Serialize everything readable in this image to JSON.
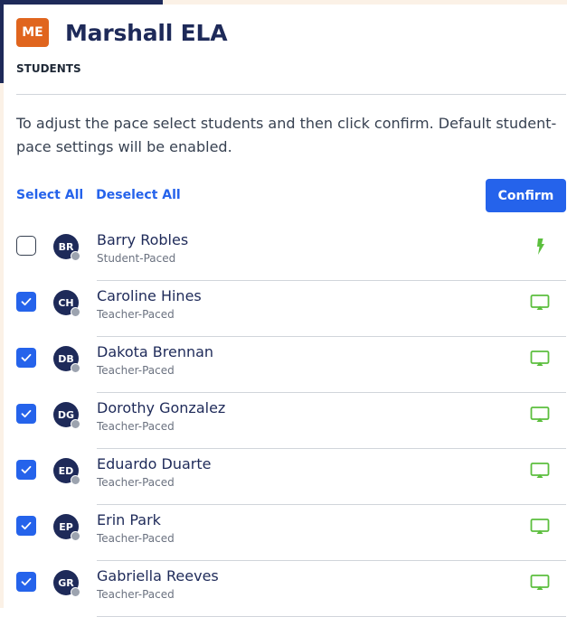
{
  "course": {
    "badge": "ME",
    "title": "Marshall ELA"
  },
  "section_label": "STUDENTS",
  "instructions": "To adjust the pace select students and then click confirm. Default student-pace settings will be enabled.",
  "actions": {
    "select_all": "Select All",
    "deselect_all": "Deselect All",
    "confirm": "Confirm"
  },
  "colors": {
    "brand_dark": "#1e2a59",
    "badge": "#e0651e",
    "primary": "#2563eb",
    "pace_icon": "#5cbf3e"
  },
  "students": [
    {
      "initials": "BR",
      "name": "Barry Robles",
      "pace": "Student-Paced",
      "checked": false,
      "icon": "lightning-bolt-icon"
    },
    {
      "initials": "CH",
      "name": "Caroline Hines",
      "pace": "Teacher-Paced",
      "checked": true,
      "icon": "presentation-screen-icon"
    },
    {
      "initials": "DB",
      "name": "Dakota Brennan",
      "pace": "Teacher-Paced",
      "checked": true,
      "icon": "presentation-screen-icon"
    },
    {
      "initials": "DG",
      "name": "Dorothy Gonzalez",
      "pace": "Teacher-Paced",
      "checked": true,
      "icon": "presentation-screen-icon"
    },
    {
      "initials": "ED",
      "name": "Eduardo Duarte",
      "pace": "Teacher-Paced",
      "checked": true,
      "icon": "presentation-screen-icon"
    },
    {
      "initials": "EP",
      "name": "Erin Park",
      "pace": "Teacher-Paced",
      "checked": true,
      "icon": "presentation-screen-icon"
    },
    {
      "initials": "GR",
      "name": "Gabriella Reeves",
      "pace": "Teacher-Paced",
      "checked": true,
      "icon": "presentation-screen-icon"
    }
  ]
}
